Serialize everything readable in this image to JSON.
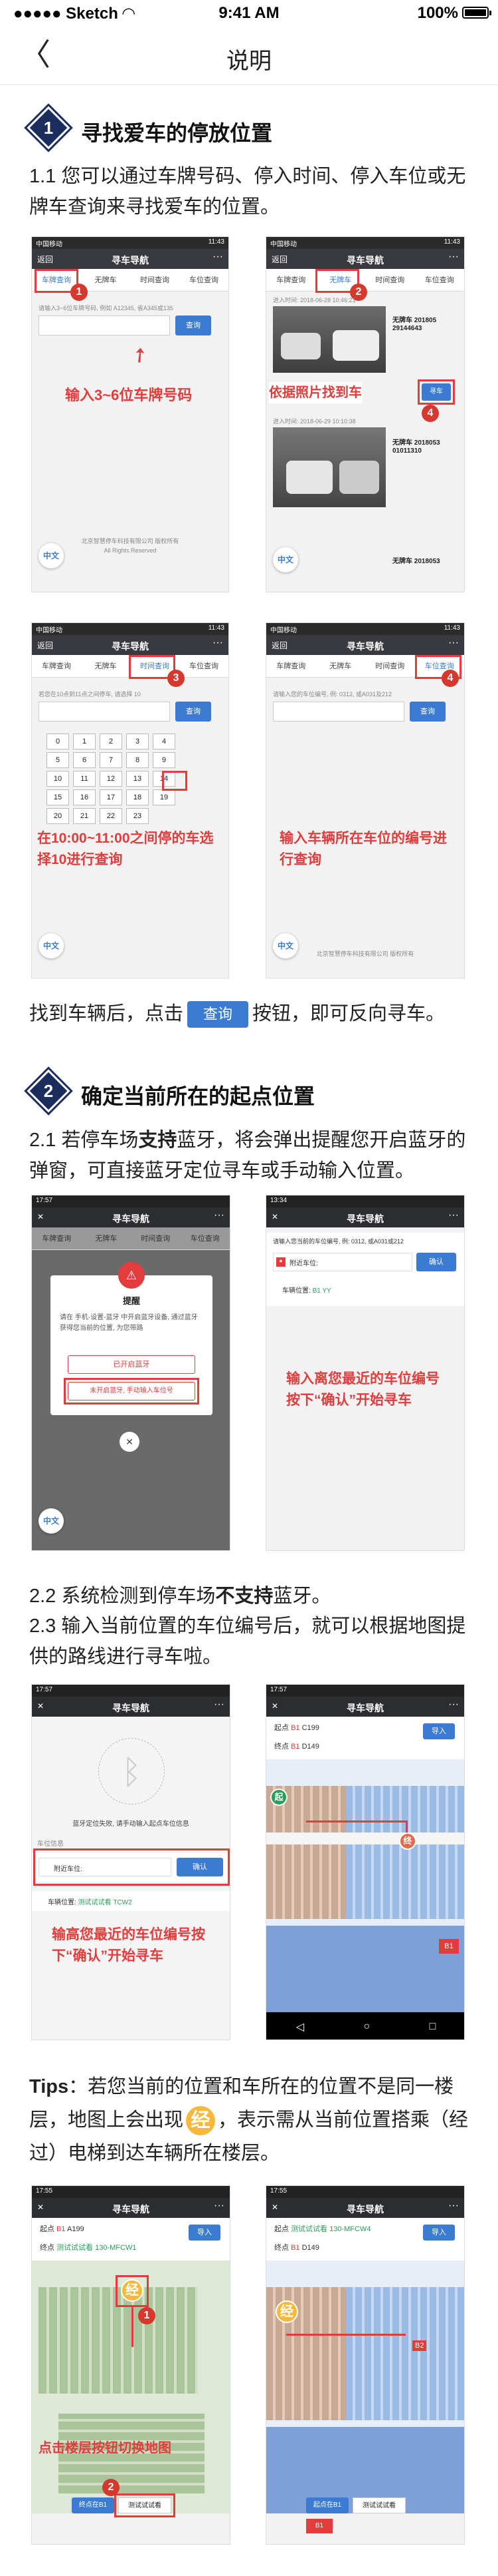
{
  "status": {
    "carrier": "Sketch",
    "time": "9:41 AM",
    "battery": "100%"
  },
  "nav": {
    "back": "〈",
    "title": "说明"
  },
  "s1": {
    "num": "1",
    "title": "寻找爱车的停放位置",
    "p1": "1.1 您可以通过车牌号码、停入时间、停入车位或无牌车查询来寻找爱车的位置。"
  },
  "phone": {
    "title": "寻车导航",
    "back": "返回",
    "menu": "···",
    "sbl": "中国移动",
    "sbr": "11:43",
    "tabs": [
      "车牌查询",
      "无牌车",
      "时间查询",
      "车位查询"
    ],
    "footer1": "北京智慧停车科技有限公司 版权所有",
    "footer2": "All Rights Reserved",
    "zh": "中文"
  },
  "p1": {
    "hint": "请输入3~6位车牌号码, 例如 A12345, 省A345或135",
    "query": "查询",
    "label": "输入3~6位车牌号码"
  },
  "p2": {
    "label": "依据照片找到车",
    "time1": "进入时间: 2018-06-28 10:46:21",
    "plate1": "无牌车 201805",
    "plate1b": "29144643",
    "time2": "进入时间: 2018-06-29 10:10:38",
    "plate2": "无牌车 2018053",
    "plate2b": "01011310",
    "plate3": "无牌车 2018053",
    "btn": "寻车"
  },
  "p3": {
    "hint": "若您在10点到11点之间停车, 请选择 10",
    "query": "查询",
    "keys": [
      [
        "0",
        "1",
        "2",
        "3",
        "4"
      ],
      [
        "5",
        "6",
        "7",
        "8",
        "9"
      ],
      [
        "10",
        "11",
        "12",
        "13",
        "14"
      ],
      [
        "15",
        "16",
        "17",
        "18",
        "19"
      ],
      [
        "20",
        "21",
        "22",
        "23",
        ""
      ]
    ],
    "label": "在10:00~11:00之间停的车选择10进行查询"
  },
  "p4": {
    "hint": "请输入您的车位编号, 例: 0312, 或A031及212",
    "query": "查询",
    "label": "输入车辆所在车位的编号进行查询"
  },
  "findLine": {
    "pre": "找到车辆后，点击",
    "btn": "查询",
    "post": "按钮，即可反向寻车。"
  },
  "s2": {
    "num": "2",
    "title": "确定当前所在的起点位置",
    "p21a": "2.1 若停车场",
    "p21b": "支持",
    "p21c": "蓝牙，将会弹出提醒您开启蓝牙的弹窗，可直接蓝牙定位寻车或手动输入位置。",
    "p22a": "2.2 系统检测到停车场",
    "p22b": "不支持",
    "p22c": "蓝牙。",
    "p23": "2.3 输入当前位置的车位编号后，就可以根据地图提供的路线进行寻车啦。"
  },
  "p5": {
    "sb": "17:57",
    "dialogTitle": "提醒",
    "dialogText": "请在 手机-设置-蓝牙 中开启蓝牙设备, 通过蓝牙获得您当前的位置, 为您带路",
    "btn1": "已开启蓝牙",
    "btn2": "未开启蓝牙, 手动输入车位号"
  },
  "p6": {
    "sb": "13:34",
    "hint": "请输入您当前的车位编号, 例: 0312, 或A031或212",
    "here": "附近车位:",
    "confirm": "确认",
    "carPos": "车辆位置:",
    "carVal": "B1 YY",
    "label": "输入离您最近的车位编号按下“确认”开始寻车"
  },
  "p7": {
    "sb": "17:57",
    "bt": "蓝牙定位失败, 请手动输入起点车位信息",
    "posLabel": "车位信息",
    "here": "附近车位:",
    "confirm": "确认",
    "carPos": "车辆位置:",
    "carVal": "测试试试看 TCW2",
    "label": "输高您最近的车位编号按下“确认”开始寻车"
  },
  "p8": {
    "sb": "17:57",
    "start": "起点",
    "startFloor": "B1",
    "startVal": "C199",
    "end": "终点",
    "endFloor": "B1",
    "endVal": "D149",
    "nav": "导入",
    "floor": "B1"
  },
  "tips": {
    "label": "Tips",
    "text1": "：若您当前的位置和车所在的位置不是同一楼层，地图上会出现",
    "icon": "经",
    "text2": "，表示需从当前位置搭乘（经过）电梯到达车辆所在楼层。"
  },
  "p9": {
    "sb": "17:55",
    "start": "起点",
    "startFloor": "B1",
    "startVal": "A199",
    "end": "终点",
    "endVal": "测试试试看 130-MFCW1",
    "nav": "导入",
    "label": "点击楼层按钮切换地图",
    "b1": "终点在B1",
    "b2": "测试试试看"
  },
  "p10": {
    "sb": "17:55",
    "start": "起点",
    "startVal": "测试试试看 130-MFCW4",
    "end": "终点",
    "endFloor": "B1",
    "endVal": "D149",
    "nav": "导入",
    "b1": "起点在B1",
    "b2": "测试试试看",
    "floorA": "B2",
    "floorB": "B1"
  },
  "colors": {
    "accent": "#1b2d5c",
    "red": "#e23c3c",
    "blue": "#3b7bd4",
    "lift": "#f6b93b"
  }
}
